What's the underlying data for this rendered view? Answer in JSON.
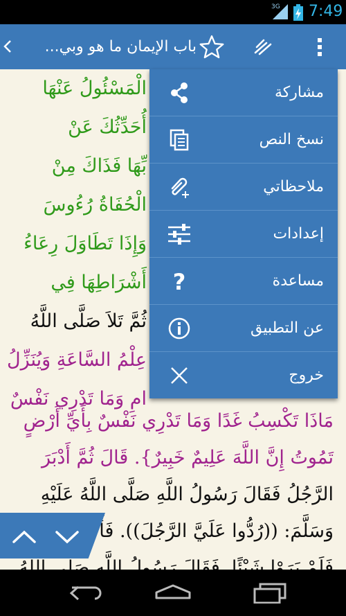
{
  "status_bar": {
    "network": "3G",
    "time": "7:49"
  },
  "action_bar": {
    "title": "باب الإيمان ما هو وبي..."
  },
  "content_lines": [
    {
      "text": "الْمَسْئُولُ عَنْهَا",
      "color": "green"
    },
    {
      "text": "أُحَدِّثُكَ عَنْ",
      "color": "green"
    },
    {
      "text": "بِّهَا فَذَاكَ مِنْ",
      "color": "green"
    },
    {
      "text": "الْحُفَاةُ رُءُوسَ",
      "color": "green"
    },
    {
      "text": "وَإِذَا تَطَاوَلَ رِعَاءُ",
      "color": "green"
    },
    {
      "text": "أَشْرَاطِهَا فِي",
      "color": "green"
    },
    {
      "text": "ثُمَّ تَلاَ صَلَّى اللَّهُ",
      "color": "black"
    },
    {
      "text": "عِلْمُ السَّاعَةِ وَيُنَزِّلُ",
      "color": "purple"
    },
    {
      "text": "امِ وَمَا تَدْرِي نَفْسٌ",
      "color": "purple"
    },
    {
      "text": "مَاذَا تَكْسِبُ غَدًا وَمَا تَدْرِي نَفْسٌ بِأَيِّ أَرْضٍ",
      "color": "purple"
    },
    {
      "text": "تَمُوتُ إِنَّ اللَّهَ عَلِيمٌ خَبِيرٌ}. قَالَ ثُمَّ أَدْبَرَ",
      "color": "mixed"
    },
    {
      "text": "الرَّجُلُ فَقَالَ رَسُولُ اللَّهِ صَلَّى اللَّهُ عَلَيْهِ",
      "color": "black"
    },
    {
      "text": "وَسَلَّمَ: ((رُدُّوا عَلَيَّ الرَّجُلَ)). فَأَخَذُوا",
      "color": "mixed"
    },
    {
      "text": "فَلَمْ يَرَوْا شَيْئًا. فَقَالَ رَسُولُ اللَّهِ صَلَّى اللَّهُ",
      "color": "black"
    }
  ],
  "menu": {
    "items": [
      {
        "label": "مشاركة",
        "icon": "share-icon"
      },
      {
        "label": "نسخ النص",
        "icon": "copy-icon"
      },
      {
        "label": "ملاحظاتي",
        "icon": "attach-add-icon"
      },
      {
        "label": "إعدادات",
        "icon": "settings-sliders-icon"
      },
      {
        "label": "مساعدة",
        "icon": "help-icon"
      },
      {
        "label": "عن التطبيق",
        "icon": "info-icon"
      },
      {
        "label": "خروج",
        "icon": "close-icon"
      }
    ]
  },
  "colors": {
    "accent": "#3c79b8",
    "background": "#f7f3e6",
    "verse_green": "#2f9a1a",
    "quran_purple": "#a0238e",
    "clock": "#33b5e5"
  }
}
